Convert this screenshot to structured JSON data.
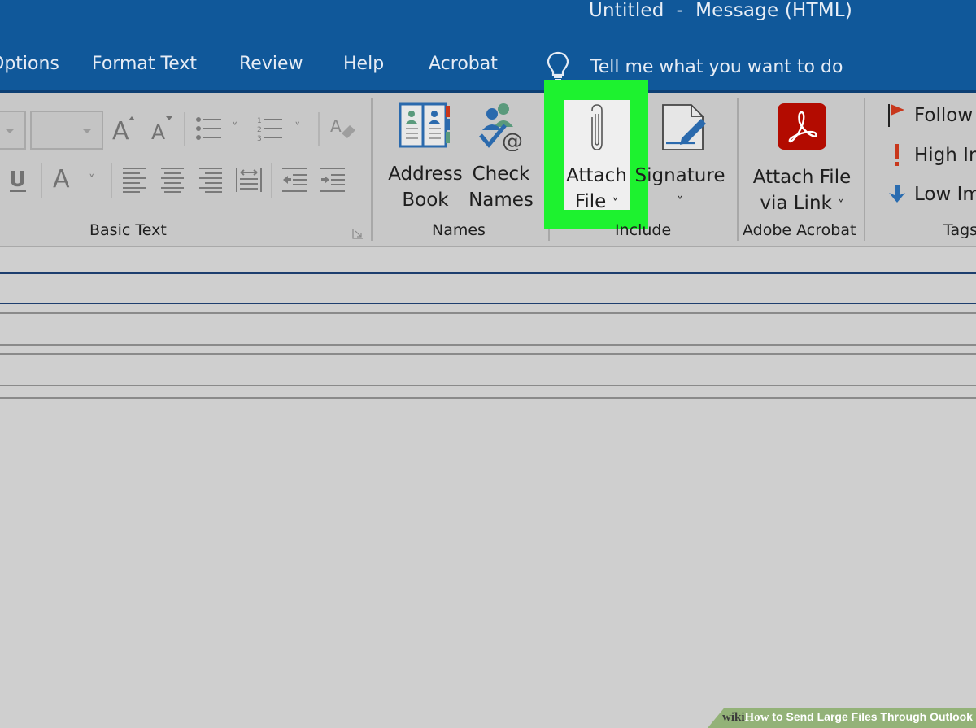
{
  "window": {
    "title": "Untitled  -  Message (HTML)"
  },
  "tabs": [
    {
      "label": "Options"
    },
    {
      "label": "Format Text"
    },
    {
      "label": "Review"
    },
    {
      "label": "Help"
    },
    {
      "label": "Acrobat"
    }
  ],
  "tell_me": {
    "icon": "lightbulb-icon",
    "text": "Tell me what you want to do"
  },
  "ribbon": {
    "groups": [
      {
        "label": "Basic Text",
        "controls": [
          "font-name-dropdown",
          "font-size-dropdown",
          "grow-font",
          "shrink-font",
          "bullets",
          "numbering",
          "clear-formatting",
          "underline",
          "font-color",
          "align-left",
          "center",
          "align-right",
          "justify",
          "decrease-indent",
          "increase-indent"
        ]
      },
      {
        "label": "Names",
        "buttons": [
          {
            "line1": "Address",
            "line2": "Book",
            "icon": "address-book-icon"
          },
          {
            "line1": "Check",
            "line2": "Names",
            "icon": "check-names-icon"
          }
        ]
      },
      {
        "label": "Include",
        "buttons": [
          {
            "line1": "Attach",
            "line2": "File",
            "icon": "paperclip-icon",
            "has_dropdown": true,
            "highlighted": true
          },
          {
            "line1": "Signature",
            "line2": "",
            "icon": "signature-icon",
            "has_dropdown": true
          }
        ]
      },
      {
        "label": "Adobe Acrobat",
        "buttons": [
          {
            "line1": "Attach File",
            "line2": "via Link",
            "icon": "acrobat-icon",
            "has_dropdown": true
          }
        ]
      },
      {
        "label": "Tags",
        "items": [
          {
            "label": "Follow Up",
            "icon": "flag-icon"
          },
          {
            "label": "High Importance",
            "icon": "exclamation-icon"
          },
          {
            "label": "Low Importance",
            "icon": "down-arrow-icon"
          }
        ]
      }
    ],
    "chevron": "˅",
    "basic_text_glyphs": {
      "underline": "U",
      "font_color": "A",
      "grow": "A",
      "shrink": "A"
    }
  },
  "colors": {
    "titlebar": "#10589a",
    "highlight": "#1df22f",
    "acrobat_red": "#b30b00",
    "flag_red": "#c8371c",
    "low_blue": "#2a6cb0"
  },
  "watermark": {
    "wiki": "wiki",
    "how": "How",
    "text": " to Send Large Files Through Outlook"
  }
}
